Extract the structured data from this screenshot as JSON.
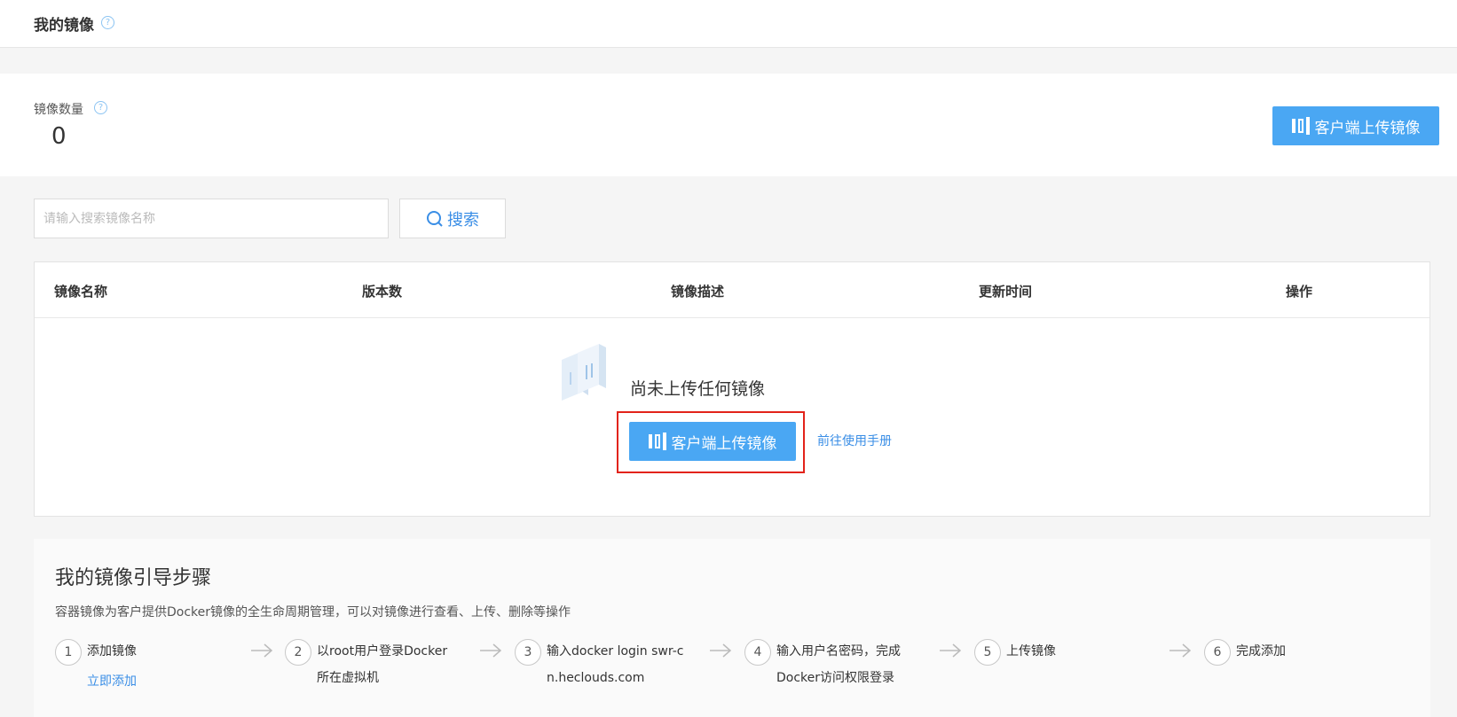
{
  "header": {
    "title": "我的镜像",
    "help_icon": "?"
  },
  "summary": {
    "label": "镜像数量",
    "count": "0",
    "upload_button": "客户端上传镜像"
  },
  "search": {
    "placeholder": "请输入搜索镜像名称",
    "button": "搜索"
  },
  "table": {
    "columns": [
      "镜像名称",
      "版本数",
      "镜像描述",
      "更新时间",
      "操作"
    ],
    "empty": {
      "message": "尚未上传任何镜像",
      "upload_button": "客户端上传镜像",
      "manual_link": "前往使用手册"
    }
  },
  "guide": {
    "title": "我的镜像引导步骤",
    "description": "容器镜像为客户提供Docker镜像的全生命周期管理，可以对镜像进行查看、上传、删除等操作",
    "steps": [
      {
        "num": "1",
        "text": "添加镜像",
        "link": "立即添加"
      },
      {
        "num": "2",
        "text": "以root用户登录Docker所在虚拟机"
      },
      {
        "num": "3",
        "text": "输入docker login swr-cn.heclouds.com"
      },
      {
        "num": "4",
        "text": "输入用户名密码，完成Docker访问权限登录"
      },
      {
        "num": "5",
        "text": "上传镜像"
      },
      {
        "num": "6",
        "text": "完成添加"
      }
    ]
  },
  "colors": {
    "primary": "#4aa7f3",
    "link": "#3a8ee6",
    "highlight": "#e2231a"
  }
}
